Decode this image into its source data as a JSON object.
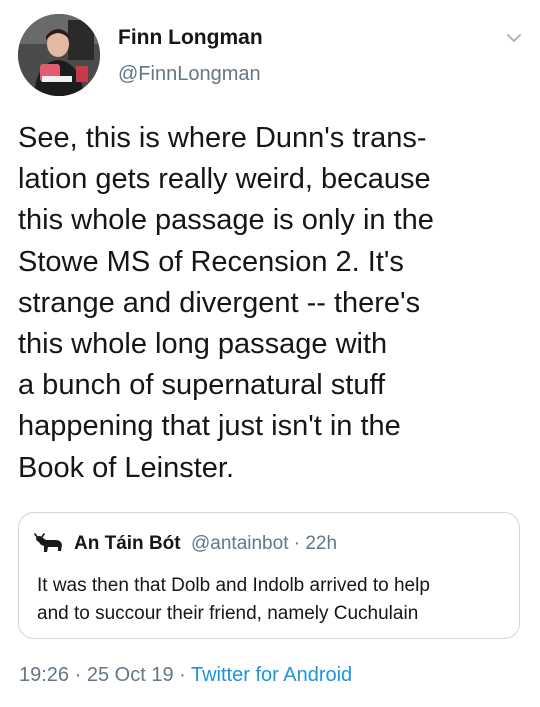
{
  "author": {
    "name": "Finn Longman",
    "handle": "@FinnLongman",
    "avatar_icon": "profile-photo"
  },
  "menu_icon": "chevron-down-icon",
  "tweet": {
    "lines": [
      "See, this is where Dunn's trans-",
      "lation gets really weird, because",
      "this whole passage is only in the",
      "Stowe MS of Recension 2. It's",
      "strange and divergent -- there's",
      "this whole long passage with",
      "a bunch of supernatural stuff",
      "happening that just isn't in the",
      "Book of Leinster."
    ]
  },
  "quoted_tweet": {
    "name": "An Táin Bót",
    "handle_time": "@antainbot · 22h",
    "avatar_icon": "bull-icon",
    "lines": [
      "It was then that Dolb and Indolb arrived to help",
      "and to succour their friend, namely Cuchulain"
    ]
  },
  "meta": {
    "time": "19:26",
    "separator1": " · ",
    "date": "25 Oct 19",
    "separator2": " · ",
    "source": "Twitter for Android"
  },
  "colors": {
    "text": "#14171a",
    "secondary": "#657786",
    "link": "#1b95e0",
    "border": "#ccd6dd"
  }
}
